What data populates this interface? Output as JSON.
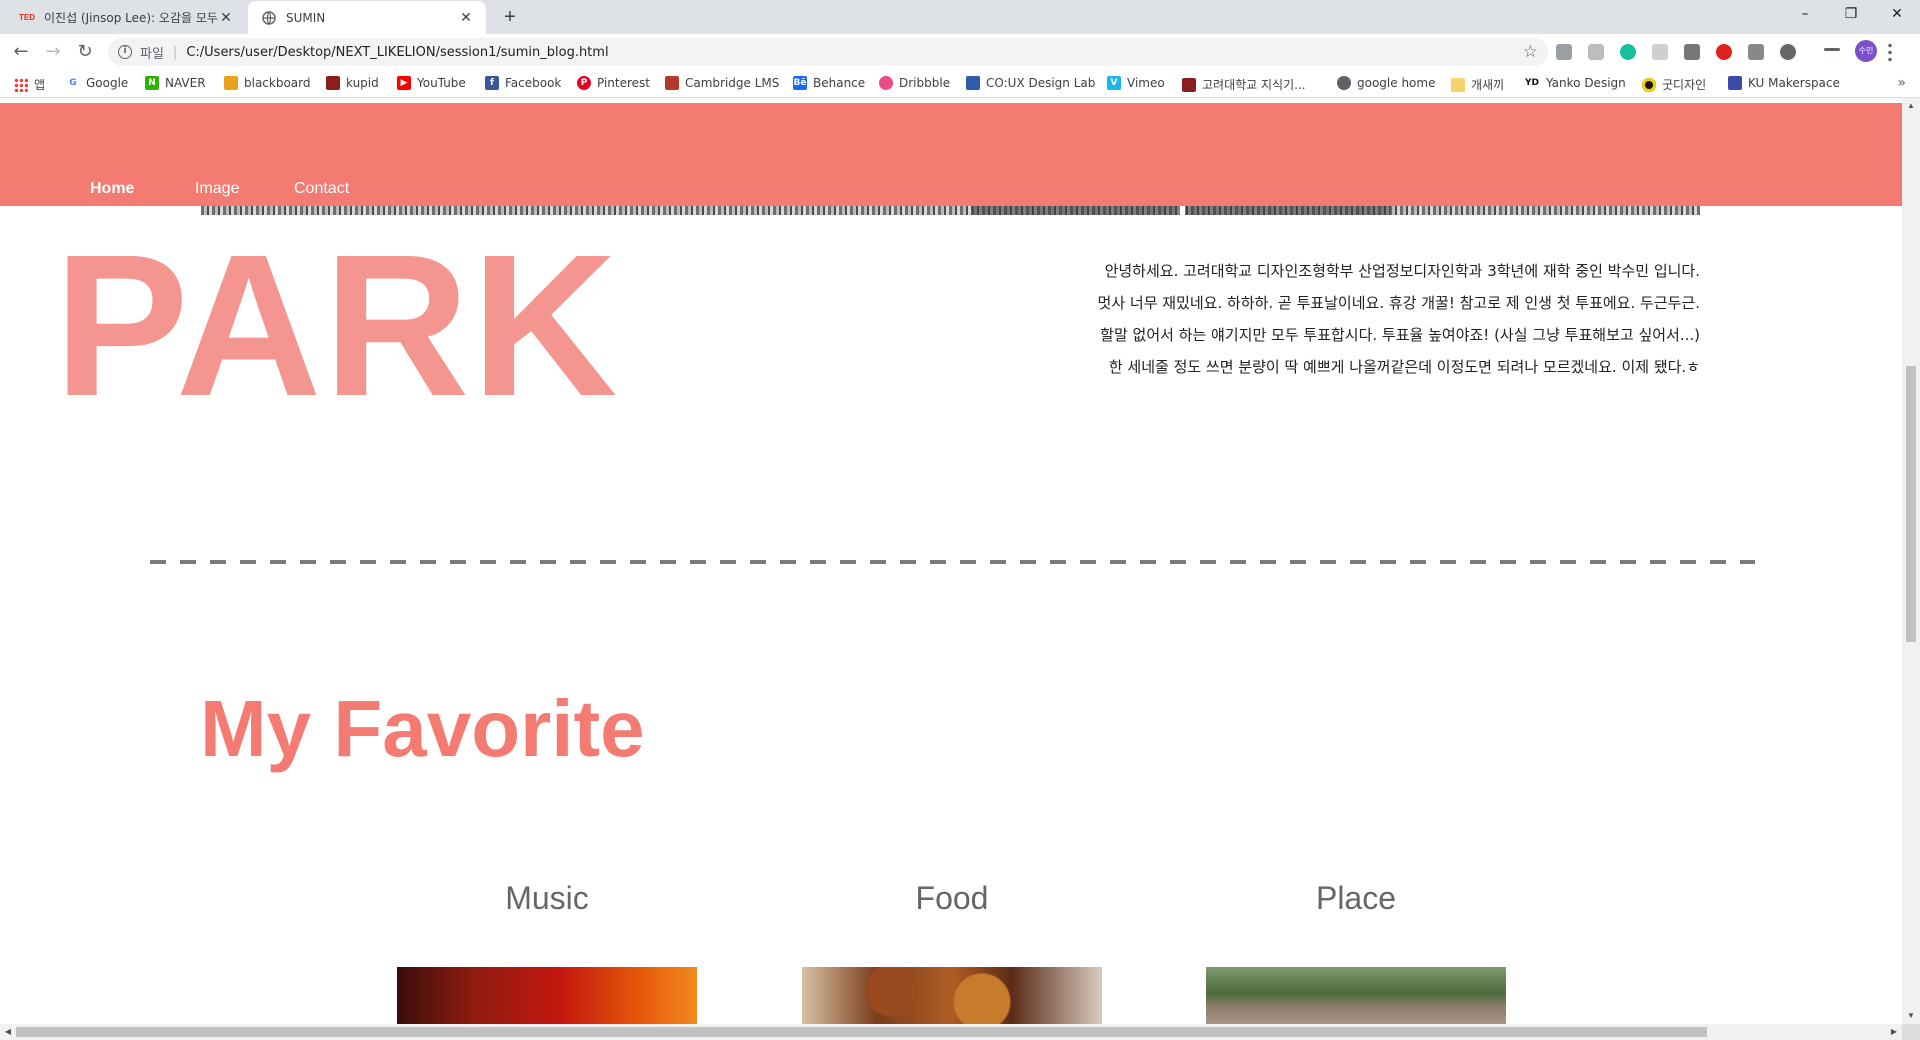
{
  "browser": {
    "tabs": [
      {
        "title": "이진섭 (Jinsop Lee): 오감을 모두",
        "favicon": "ted-logo-icon",
        "favicon_text": "TED",
        "active": false
      },
      {
        "title": "SUMIN",
        "favicon": "globe-icon",
        "active": true
      }
    ],
    "new_tab_label": "+",
    "window_controls": {
      "minimize": "–",
      "restore": "❐",
      "close": "✕"
    },
    "address": {
      "scheme_label": "파일",
      "url": "C:/Users/user/Desktop/NEXT_LIKELION/session1/sumin_blog.html"
    },
    "profile_initials": "수민",
    "bookmarks": [
      {
        "label": "앱",
        "icon": "apps-grid-icon",
        "color": "#e8453c"
      },
      {
        "label": "Google",
        "icon": "google-icon",
        "color": "#4285f4"
      },
      {
        "label": "NAVER",
        "icon": "naver-icon",
        "color": "#2db400"
      },
      {
        "label": "blackboard",
        "icon": "blackboard-icon",
        "color": "#e8a21d"
      },
      {
        "label": "kupid",
        "icon": "korea-univ-crest-icon",
        "color": "#8b1e1e"
      },
      {
        "label": "YouTube",
        "icon": "youtube-icon",
        "color": "#ff0000"
      },
      {
        "label": "Facebook",
        "icon": "facebook-icon",
        "color": "#3b5998"
      },
      {
        "label": "Pinterest",
        "icon": "pinterest-icon",
        "color": "#e60023"
      },
      {
        "label": "Cambridge LMS",
        "icon": "cambridge-icon",
        "color": "#b23a2a"
      },
      {
        "label": "Behance",
        "icon": "behance-icon",
        "color": "#1769ff"
      },
      {
        "label": "Dribbble",
        "icon": "dribbble-icon",
        "color": "#ea4c89"
      },
      {
        "label": "CO:UX Design Lab",
        "icon": "couxlab-icon",
        "color": "#2d5ca8"
      },
      {
        "label": "Vimeo",
        "icon": "vimeo-icon",
        "color": "#1ab7ea"
      },
      {
        "label": "고려대학교 지식기...",
        "icon": "korea-univ-crest-icon",
        "color": "#8b1e1e"
      },
      {
        "label": "google home",
        "icon": "globe-icon",
        "color": "#5f6368"
      },
      {
        "label": "개새끼",
        "icon": "folder-icon",
        "color": "#f5d36a"
      },
      {
        "label": "Yanko Design",
        "icon": "yanko-design-icon",
        "color": "#111111",
        "icon_text": "YD"
      },
      {
        "label": "굿디자인",
        "icon": "good-design-icon",
        "color": "#111111"
      },
      {
        "label": "KU Makerspace",
        "icon": "makerspace-icon",
        "color": "#3b4aa8"
      }
    ],
    "bookmarks_overflow": "»"
  },
  "page": {
    "nav": {
      "home": "Home",
      "image": "Image",
      "contact": "Contact"
    },
    "hero_title": "PARK",
    "intro_lines": [
      "안녕하세요. 고려대학교 디자인조형학부 산업정보디자인학과 3학년에 재학 중인 박수민 입니다.",
      "멋사 너무 재밌네요. 하하하. 곧 투표날이네요. 휴강 개꿀! 참고로 제 인생 첫 투표에요. 두근두근.",
      "할말 없어서 하는 얘기지만 모두 투표합시다. 투표율 높여야죠! (사실 그냥 투표해보고 싶어서...)",
      "한 세네줄 정도 쓰면 분량이 딱 예쁘게 나올꺼같은데 이정도면 되려나 모르겠네요. 이제 됐다.ㅎ"
    ],
    "favorite_title": "My Favorite",
    "favorites": [
      {
        "label": "Music"
      },
      {
        "label": "Food"
      },
      {
        "label": "Place"
      }
    ],
    "colors": {
      "header": "#f37b72",
      "hero_title": "#f4968f",
      "section_title": "#f37b72"
    }
  }
}
